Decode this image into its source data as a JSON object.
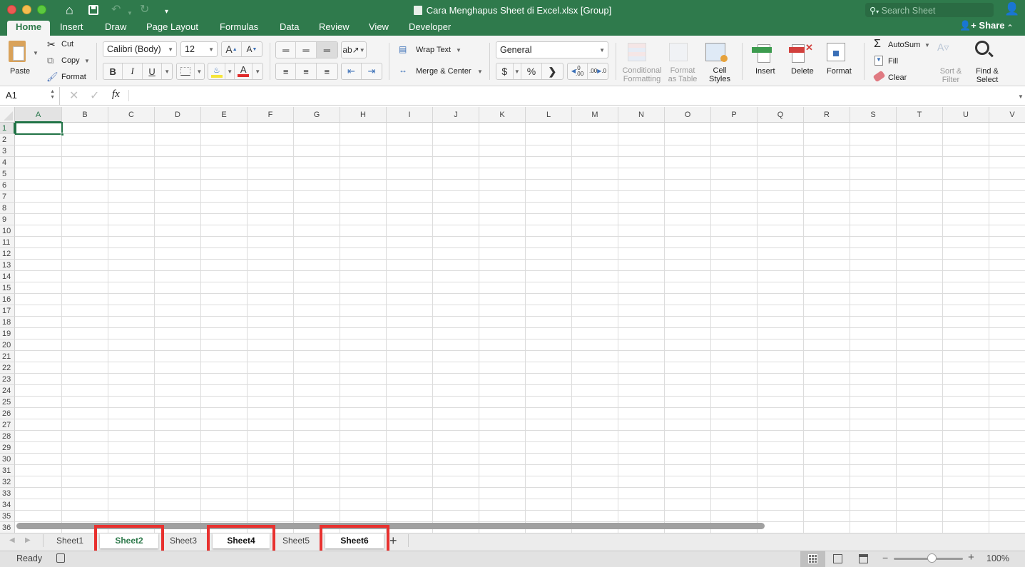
{
  "window": {
    "title": "Cara Menghapus Sheet di Excel.xlsx  [Group]",
    "search_placeholder": "Search Sheet",
    "share_label": "Share"
  },
  "ribbon_tabs": [
    "Home",
    "Insert",
    "Draw",
    "Page Layout",
    "Formulas",
    "Data",
    "Review",
    "View",
    "Developer"
  ],
  "active_tab": "Home",
  "clipboard": {
    "paste": "Paste",
    "cut": "Cut",
    "copy": "Copy",
    "format": "Format"
  },
  "font": {
    "name": "Calibri (Body)",
    "size": "12",
    "bold": "B",
    "italic": "I",
    "underline": "U",
    "grow": "A",
    "shrink": "A",
    "fill_color": "#f5e53a",
    "font_color": "#e02c2c"
  },
  "alignment": {
    "wrap_text": "Wrap Text",
    "merge_center": "Merge & Center"
  },
  "number": {
    "format": "General",
    "currency": "$",
    "percent": "%",
    "comma": "›",
    "inc_decimal": "←.0\n.00",
    "dec_decimal": ".00\n→.0"
  },
  "styles": {
    "conditional_formatting": [
      "Conditional",
      "Formatting"
    ],
    "format_as_table": [
      "Format",
      "as Table"
    ],
    "cell_styles": [
      "Cell",
      "Styles"
    ]
  },
  "cells": {
    "insert": "Insert",
    "delete": "Delete",
    "format": "Format"
  },
  "editing": {
    "autosum": "AutoSum",
    "fill": "Fill",
    "clear": "Clear",
    "sort_filter": [
      "Sort &",
      "Filter"
    ],
    "find_select": [
      "Find &",
      "Select"
    ]
  },
  "formula_bar": {
    "name_box": "A1",
    "fx": "fx",
    "value": ""
  },
  "grid": {
    "columns": [
      "A",
      "B",
      "C",
      "D",
      "E",
      "F",
      "G",
      "H",
      "I",
      "J",
      "K",
      "L",
      "M",
      "N",
      "O",
      "P",
      "Q",
      "R",
      "S",
      "T",
      "U",
      "V"
    ],
    "rows": [
      "1",
      "2",
      "3",
      "4",
      "5",
      "6",
      "7",
      "8",
      "9",
      "10",
      "11",
      "12",
      "13",
      "14",
      "15",
      "16",
      "17",
      "18",
      "19",
      "20",
      "21",
      "22",
      "23",
      "24",
      "25",
      "26",
      "27",
      "28",
      "29",
      "30",
      "31",
      "32",
      "33",
      "34",
      "35",
      "36"
    ],
    "selected_cell": "A1",
    "accent": "#217346"
  },
  "sheets": [
    {
      "name": "Sheet1",
      "selected": false,
      "active": false,
      "highlighted": false
    },
    {
      "name": "Sheet2",
      "selected": true,
      "active": true,
      "highlighted": true
    },
    {
      "name": "Sheet3",
      "selected": false,
      "active": false,
      "highlighted": false
    },
    {
      "name": "Sheet4",
      "selected": true,
      "active": false,
      "highlighted": true
    },
    {
      "name": "Sheet5",
      "selected": false,
      "active": false,
      "highlighted": false
    },
    {
      "name": "Sheet6",
      "selected": true,
      "active": false,
      "highlighted": true
    }
  ],
  "add_sheet": "+",
  "status": {
    "text": "Ready",
    "zoom": "100%",
    "zoom_level": 1.0,
    "highlight_color": "#e8312f"
  }
}
